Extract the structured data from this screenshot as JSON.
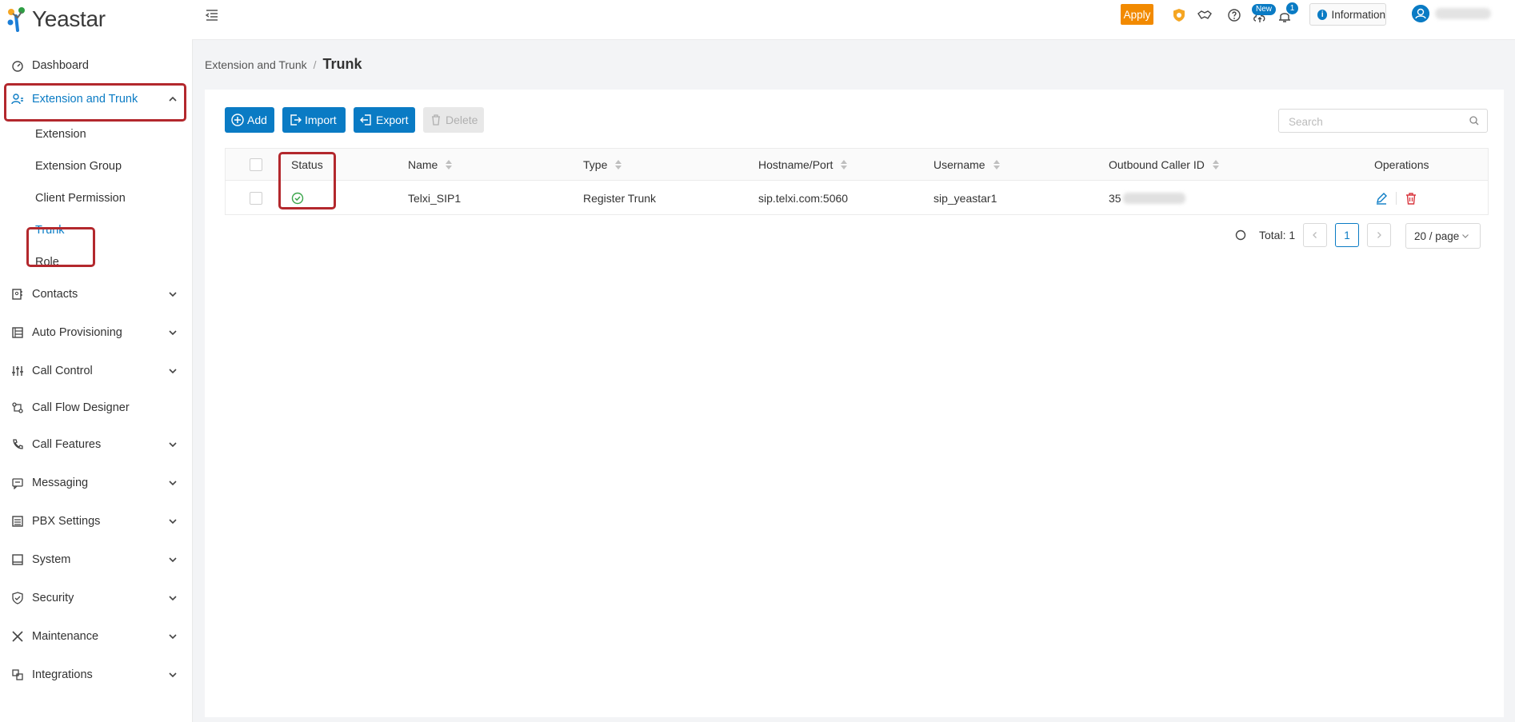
{
  "brand": {
    "name": "Yeastar"
  },
  "topbar": {
    "apply_label": "Apply",
    "new_badge": "New",
    "notification_count": "1",
    "information_label": "Information"
  },
  "sidebar": {
    "dashboard": "Dashboard",
    "extension_and_trunk": "Extension and Trunk",
    "sub": {
      "extension": "Extension",
      "extension_group": "Extension Group",
      "client_permission": "Client Permission",
      "trunk": "Trunk",
      "role": "Role"
    },
    "contacts": "Contacts",
    "auto_provisioning": "Auto Provisioning",
    "call_control": "Call Control",
    "call_flow_designer": "Call Flow Designer",
    "call_features": "Call Features",
    "messaging": "Messaging",
    "pbx_settings": "PBX Settings",
    "system": "System",
    "security": "Security",
    "maintenance": "Maintenance",
    "integrations": "Integrations"
  },
  "breadcrumb": {
    "parent": "Extension and Trunk",
    "separator": "/",
    "current": "Trunk"
  },
  "toolbar": {
    "add_label": "Add",
    "import_label": "Import",
    "export_label": "Export",
    "delete_label": "Delete",
    "search_placeholder": "Search"
  },
  "table": {
    "columns": {
      "status": "Status",
      "name": "Name",
      "type": "Type",
      "hostname": "Hostname/Port",
      "username": "Username",
      "caller_id": "Outbound Caller ID",
      "operations": "Operations"
    },
    "rows": [
      {
        "status": "registered",
        "name": "Telxi_SIP1",
        "type": "Register Trunk",
        "hostname": "sip.telxi.com:5060",
        "username": "sip_yeastar1",
        "caller_id_visible": "35"
      }
    ]
  },
  "pagination": {
    "total_label": "Total: 1",
    "current_page": "1",
    "page_size": "20 / page"
  },
  "colors": {
    "accent": "#0a7bc4",
    "apply": "#f28a00",
    "highlight": "#b3282d",
    "status_ok": "#3aa54a",
    "delete_icon": "#d9363e"
  }
}
